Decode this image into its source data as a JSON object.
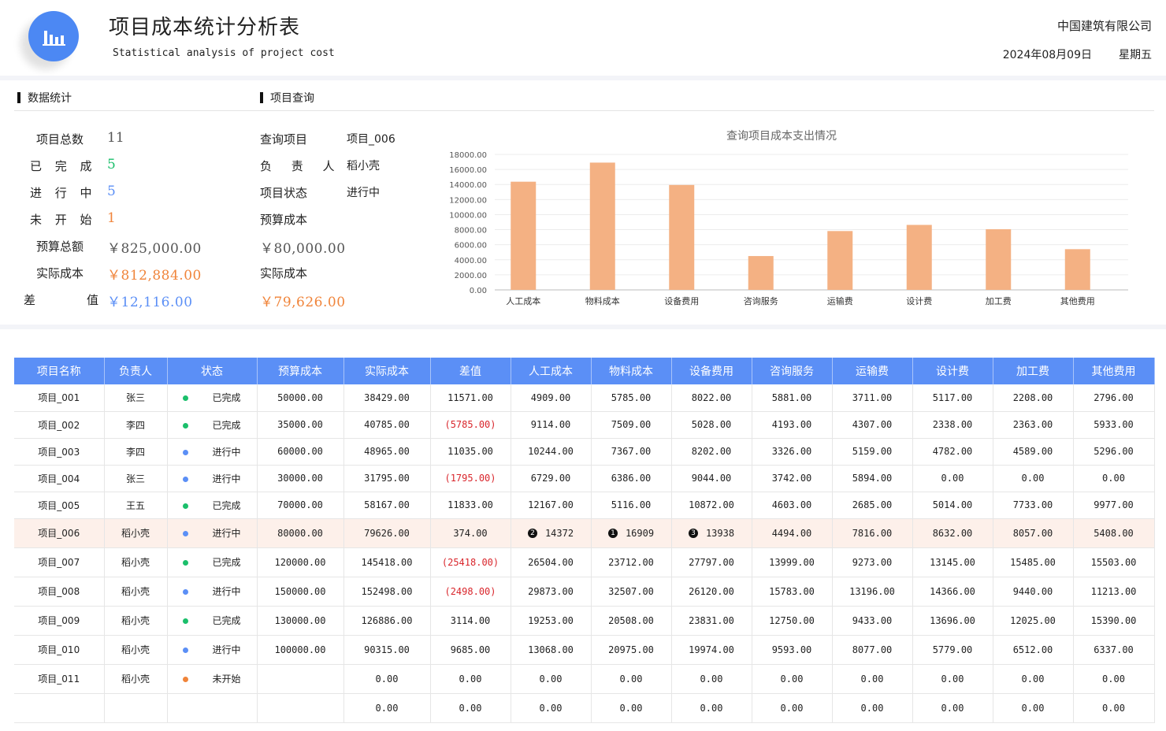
{
  "header": {
    "title": "项目成本统计分析表",
    "subtitle": "Statistical analysis of project cost",
    "company": "中国建筑有限公司",
    "date": "2024年08月09日",
    "weekday": "星期五"
  },
  "stats": {
    "section_title": "数据统计",
    "total_label": "项目总数",
    "total_value": "11",
    "done_label": "已 完 成",
    "done_value": "5",
    "doing_label": "进 行 中",
    "doing_value": "5",
    "todo_label": "未 开 始",
    "todo_value": "1",
    "budget_label": "预算总额",
    "budget_value": "￥825,000.00",
    "actual_label": "实际成本",
    "actual_value": "￥812,884.00",
    "diff_label_a": "差",
    "diff_label_b": "值",
    "diff_value": "￥12,116.00",
    "colors": {
      "done": "#1bbf6b",
      "doing": "#5b8ff6",
      "todo": "#f0843a",
      "budget": "#555555",
      "actual": "#f0843a",
      "diff": "#5b8ff6"
    }
  },
  "query": {
    "section_title": "项目查询",
    "project_label": "查询项目",
    "project_value": "项目_006",
    "owner_label": "负 责 人",
    "owner_value": "稻小壳",
    "status_label": "项目状态",
    "status_value": "进行中",
    "budget_label": "预算成本",
    "budget_value": "￥80,000.00",
    "actual_label": "实际成本",
    "actual_value": "￥79,626.00"
  },
  "chart_data": {
    "type": "bar",
    "title": "查询项目成本支出情况",
    "categories": [
      "人工成本",
      "物料成本",
      "设备费用",
      "咨询服务",
      "运输费",
      "设计费",
      "加工费",
      "其他费用"
    ],
    "values": [
      14372,
      16909,
      13938,
      4494,
      7816,
      8632,
      8057,
      5408
    ],
    "yticks": [
      "0.00",
      "2000.00",
      "4000.00",
      "6000.00",
      "8000.00",
      "10000.00",
      "12000.00",
      "14000.00",
      "16000.00",
      "18000.00"
    ],
    "ylim": [
      0,
      18000
    ],
    "grid": true,
    "color": "#f4b183"
  },
  "table": {
    "headers": [
      "项目名称",
      "负责人",
      "状态",
      "预算成本",
      "实际成本",
      "差值",
      "人工成本",
      "物料成本",
      "设备费用",
      "咨询服务",
      "运输费",
      "设计费",
      "加工费",
      "其他费用"
    ],
    "rows": [
      [
        "项目_001",
        "张三",
        "已完成",
        "50000.00",
        "38429.00",
        "11571.00",
        "4909.00",
        "5785.00",
        "8022.00",
        "5881.00",
        "3711.00",
        "5117.00",
        "2208.00",
        "2796.00"
      ],
      [
        "项目_002",
        "李四",
        "已完成",
        "35000.00",
        "40785.00",
        "(5785.00)",
        "9114.00",
        "7509.00",
        "5028.00",
        "4193.00",
        "4307.00",
        "2338.00",
        "2363.00",
        "5933.00"
      ],
      [
        "项目_003",
        "李四",
        "进行中",
        "60000.00",
        "48965.00",
        "11035.00",
        "10244.00",
        "7367.00",
        "8202.00",
        "3326.00",
        "5159.00",
        "4782.00",
        "4589.00",
        "5296.00"
      ],
      [
        "项目_004",
        "张三",
        "进行中",
        "30000.00",
        "31795.00",
        "(1795.00)",
        "6729.00",
        "6386.00",
        "9044.00",
        "3742.00",
        "5894.00",
        "0.00",
        "0.00",
        "0.00"
      ],
      [
        "项目_005",
        "王五",
        "已完成",
        "70000.00",
        "58167.00",
        "11833.00",
        "12167.00",
        "5116.00",
        "10872.00",
        "4603.00",
        "2685.00",
        "5014.00",
        "7733.00",
        "9977.00"
      ],
      [
        "项目_006",
        "稻小壳",
        "进行中",
        "80000.00",
        "79626.00",
        "374.00",
        "14372",
        "16909",
        "13938",
        "4494.00",
        "7816.00",
        "8632.00",
        "8057.00",
        "5408.00"
      ],
      [
        "项目_007",
        "稻小壳",
        "已完成",
        "120000.00",
        "145418.00",
        "(25418.00)",
        "26504.00",
        "23712.00",
        "27797.00",
        "13999.00",
        "9273.00",
        "13145.00",
        "15485.00",
        "15503.00"
      ],
      [
        "项目_008",
        "稻小壳",
        "进行中",
        "150000.00",
        "152498.00",
        "(2498.00)",
        "29873.00",
        "32507.00",
        "26120.00",
        "15783.00",
        "13196.00",
        "14366.00",
        "9440.00",
        "11213.00"
      ],
      [
        "项目_009",
        "稻小壳",
        "已完成",
        "130000.00",
        "126886.00",
        "3114.00",
        "19253.00",
        "20508.00",
        "23831.00",
        "12750.00",
        "9433.00",
        "13696.00",
        "12025.00",
        "15390.00"
      ],
      [
        "项目_010",
        "稻小壳",
        "进行中",
        "100000.00",
        "90315.00",
        "9685.00",
        "13068.00",
        "20975.00",
        "19974.00",
        "9593.00",
        "8077.00",
        "5779.00",
        "6512.00",
        "6337.00"
      ],
      [
        "项目_011",
        "稻小壳",
        "未开始",
        "",
        "0.00",
        "0.00",
        "0.00",
        "0.00",
        "0.00",
        "0.00",
        "0.00",
        "0.00",
        "0.00",
        "0.00"
      ],
      [
        "",
        "",
        "",
        "",
        "0.00",
        "0.00",
        "0.00",
        "0.00",
        "0.00",
        "0.00",
        "0.00",
        "0.00",
        "0.00",
        "0.00"
      ]
    ],
    "highlight_row": 5,
    "rank_marks": {
      "6": "2",
      "7": "1",
      "8": "3"
    },
    "status_colors": {
      "已完成": "#1bbf6b",
      "进行中": "#5b8ff6",
      "未开始": "#f0843a"
    }
  }
}
